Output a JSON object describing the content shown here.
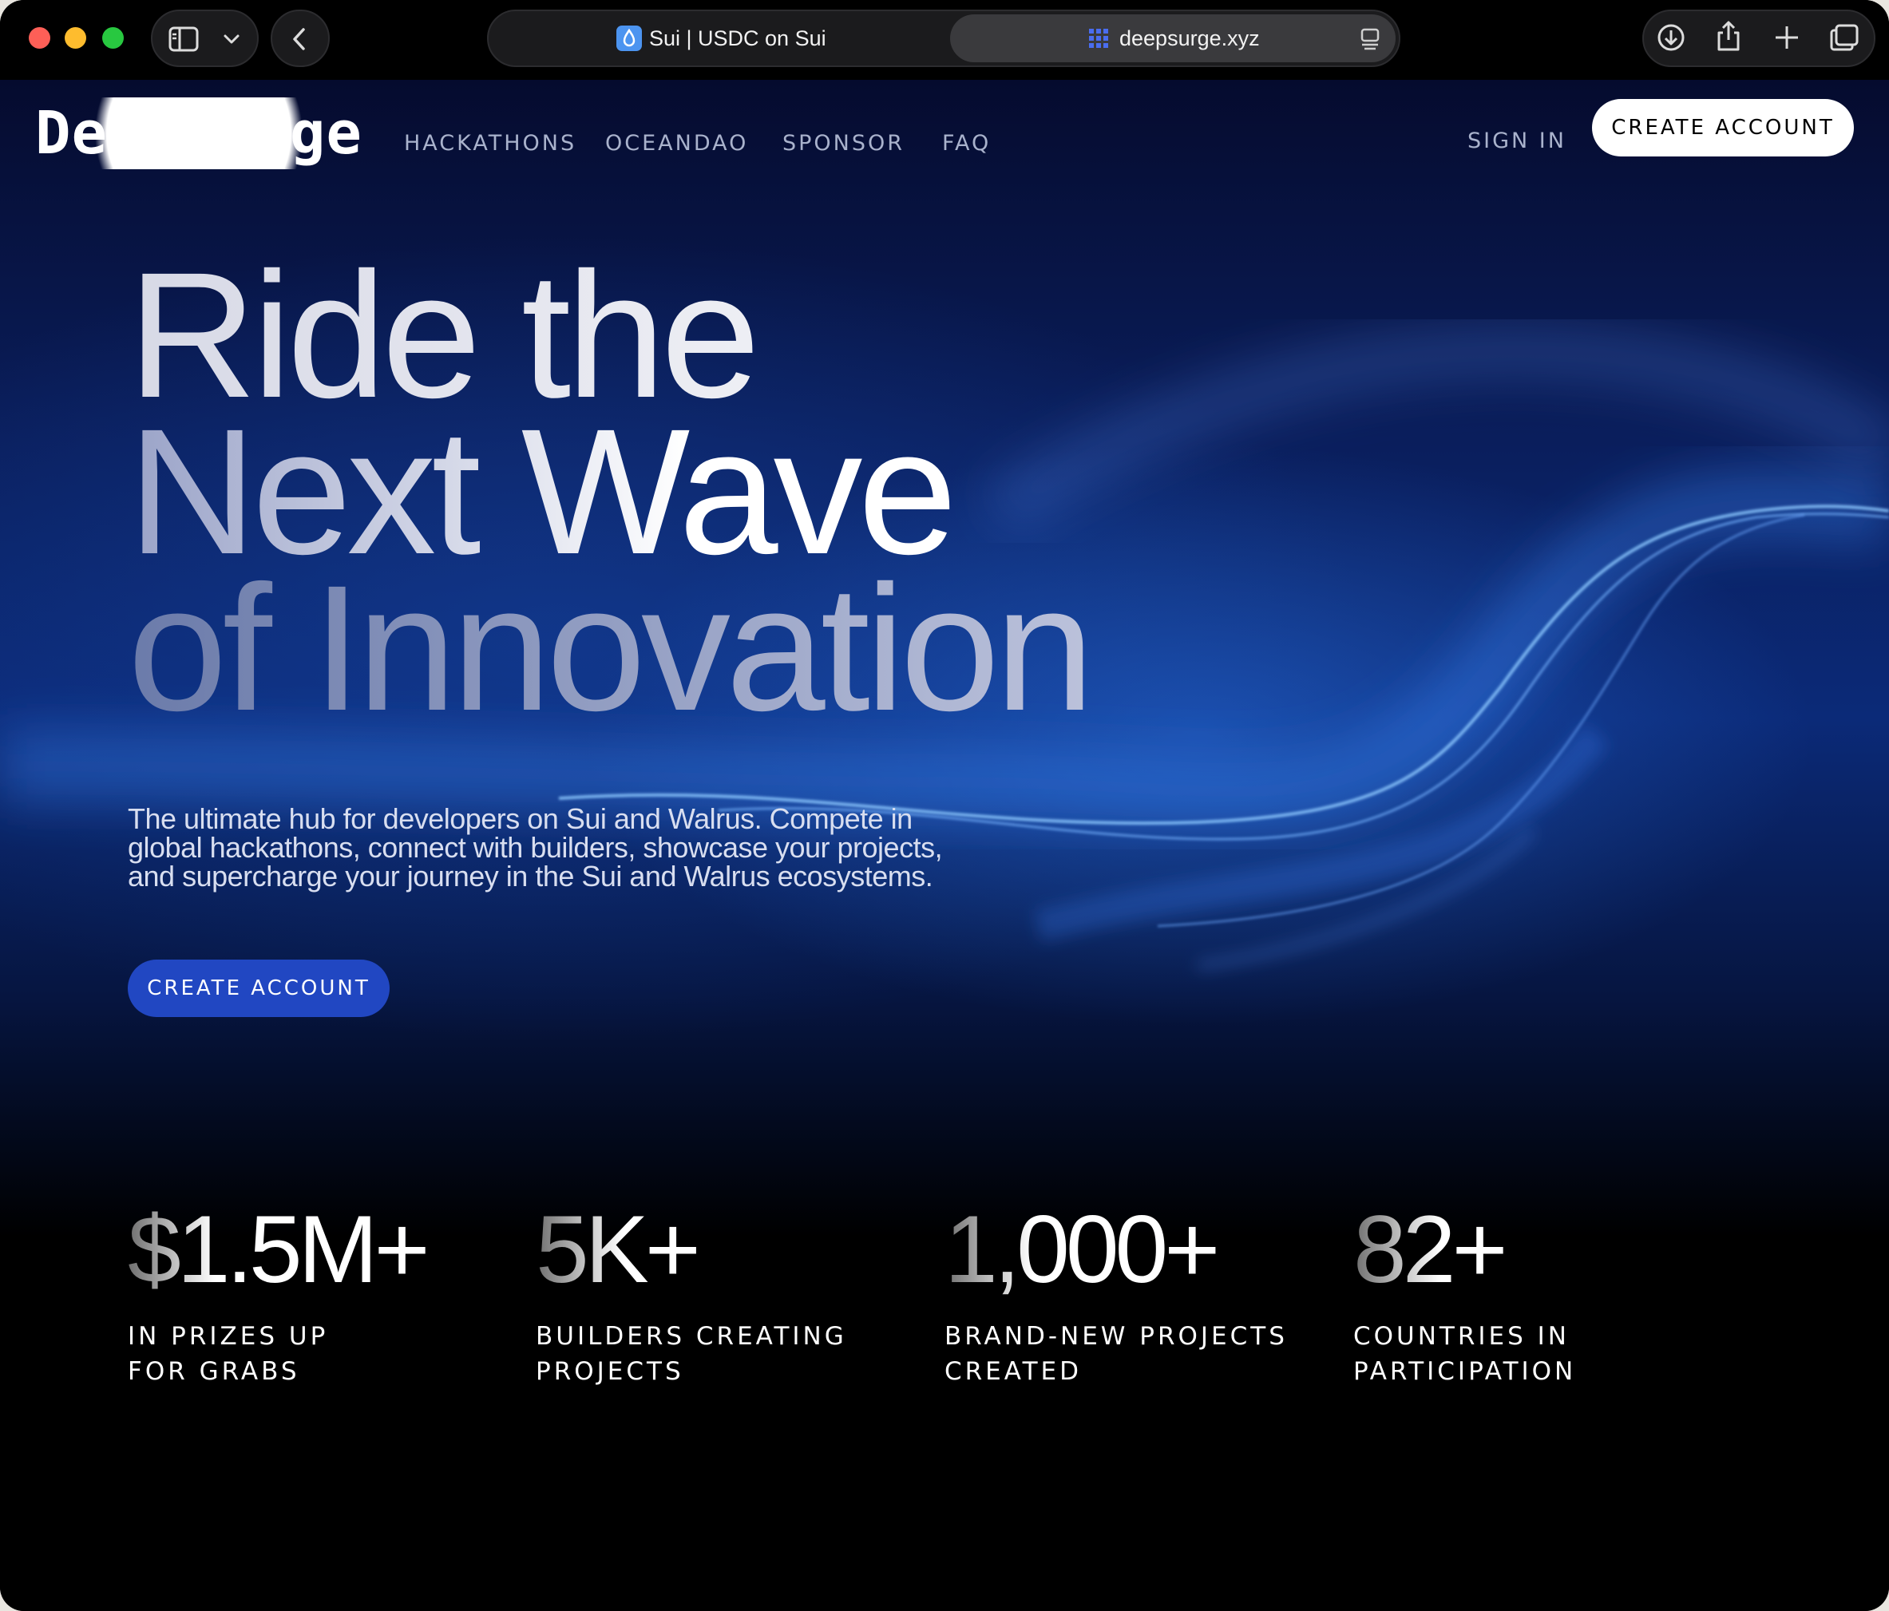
{
  "browser": {
    "tabs": [
      {
        "title": "Sui | USDC on Sui",
        "favicon": "sui-drop-icon"
      },
      {
        "title": "deepsurge.xyz",
        "favicon": "deepsurge-grid-icon",
        "active": true
      }
    ],
    "icons": [
      "sidebar-icon",
      "chevron-down-icon",
      "back-chevron-icon",
      "reader-icon",
      "download-icon",
      "share-icon",
      "plus-icon",
      "tab-overview-icon"
    ]
  },
  "nav": {
    "logo": "DeepSurge",
    "links": [
      "HACKATHONS",
      "OCEANDAO",
      "SPONSOR",
      "FAQ"
    ],
    "sign_in": "SIGN IN",
    "create_account": "CREATE ACCOUNT"
  },
  "hero": {
    "headline": [
      "Ride the",
      "Next Wave",
      "of Innovation"
    ],
    "subtitle": "The ultimate hub for developers on Sui and Walrus. Compete in global hackathons, connect with builders, showcase your projects, and supercharge your journey in the Sui and Walrus ecosystems.",
    "cta": "CREATE ACCOUNT"
  },
  "stats": [
    {
      "value": "$1.5M+",
      "label": "IN PRIZES UP FOR GRABS"
    },
    {
      "value": "5K+",
      "label": "BUILDERS CREATING PROJECTS"
    },
    {
      "value": "1,000+",
      "label": "BRAND-NEW PROJECTS CREATED"
    },
    {
      "value": "82+",
      "label": "COUNTRIES IN PARTICIPATION"
    }
  ],
  "colors": {
    "accent": "#2147c2",
    "background_dark": "#000000",
    "hero_blue": "#0b2a78",
    "traffic_red": "#fe5f57",
    "traffic_yellow": "#febc2e",
    "traffic_green": "#28c840"
  }
}
